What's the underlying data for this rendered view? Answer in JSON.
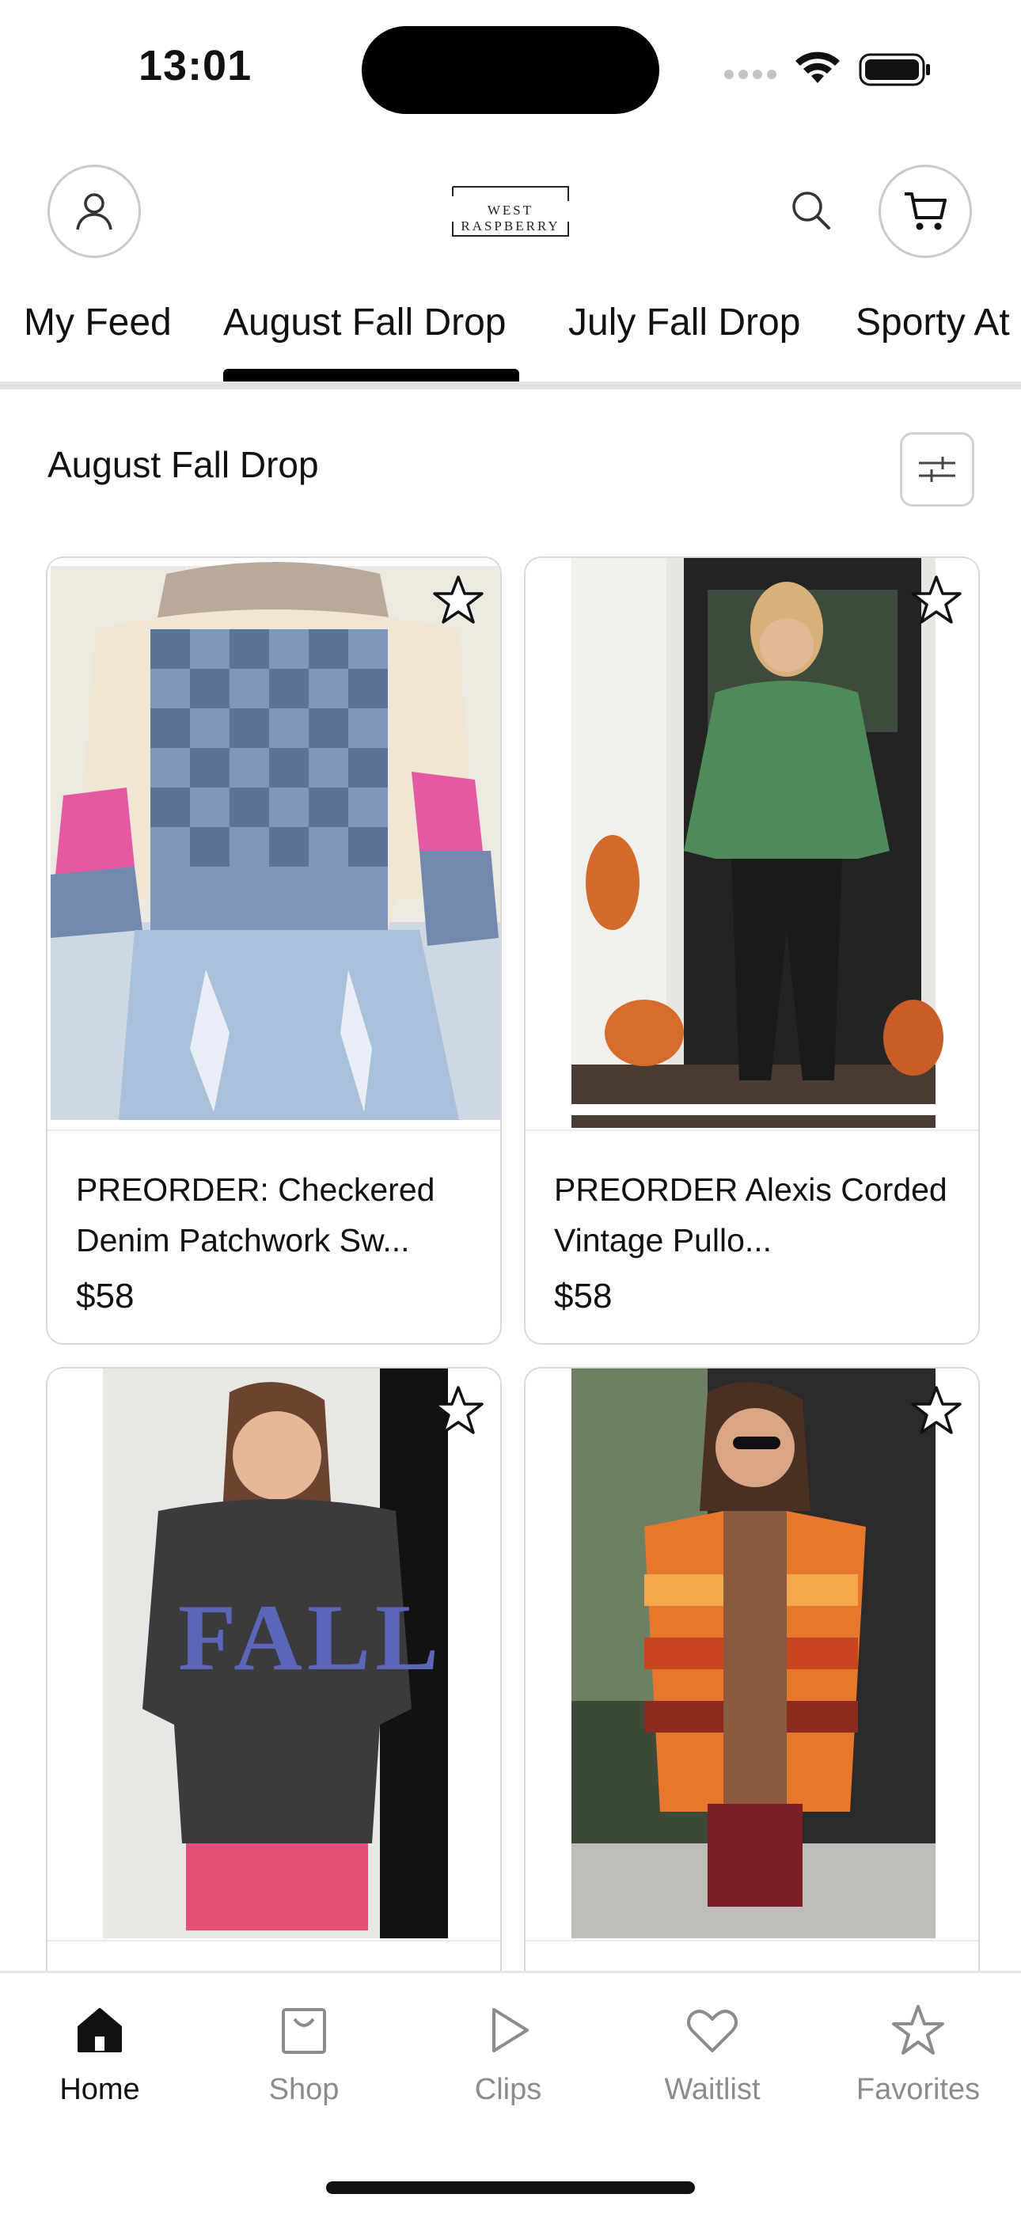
{
  "status_bar": {
    "time": "13:01"
  },
  "header": {
    "logo_text": "WEST RASPBERRY",
    "icons": {
      "profile": "person-icon",
      "search": "search-icon",
      "cart": "cart-icon"
    }
  },
  "tabs": [
    {
      "label": "My Feed",
      "active": false
    },
    {
      "label": "August Fall Drop",
      "active": true
    },
    {
      "label": "July Fall Drop",
      "active": false
    },
    {
      "label": "Sporty At",
      "active": false
    }
  ],
  "section": {
    "title": "August Fall Drop",
    "filter_icon": "sliders-icon"
  },
  "products": [
    {
      "name": "PREORDER: Checkered Denim Patchwork Sw...",
      "price": "$58",
      "favorite": false
    },
    {
      "name": "PREORDER Alexis Corded Vintage Pullo...",
      "price": "$58",
      "favorite": false
    },
    {
      "name": "",
      "price": "",
      "favorite": false
    },
    {
      "name": "",
      "price": "",
      "favorite": false
    }
  ],
  "bottom_nav": [
    {
      "label": "Home",
      "icon": "home-icon",
      "active": true
    },
    {
      "label": "Shop",
      "icon": "bag-icon",
      "active": false
    },
    {
      "label": "Clips",
      "icon": "play-icon",
      "active": false
    },
    {
      "label": "Waitlist",
      "icon": "heart-icon",
      "active": false
    },
    {
      "label": "Favorites",
      "icon": "star-icon",
      "active": false
    }
  ],
  "colors": {
    "accent": "#000000",
    "inactive": "#8c8c8c",
    "divider": "#dfe1e4"
  }
}
